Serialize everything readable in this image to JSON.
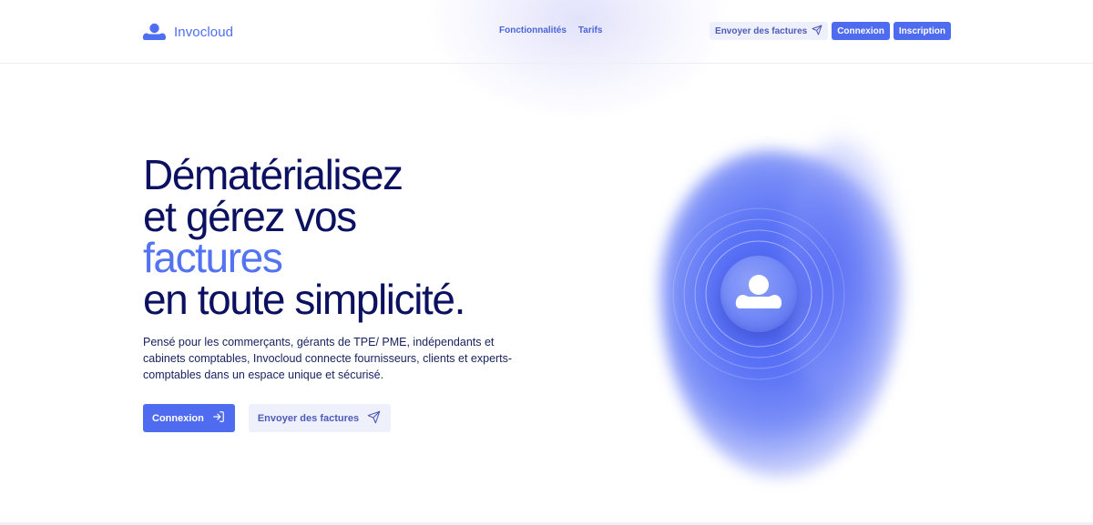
{
  "brand": {
    "name": "Invocloud",
    "logo_icon": "cloud-user-icon"
  },
  "nav": {
    "items": [
      {
        "label": "Fonctionnalités"
      },
      {
        "label": "Tarifs"
      }
    ]
  },
  "header_actions": {
    "send_invoices": "Envoyer des factures",
    "login": "Connexion",
    "signup": "Inscription"
  },
  "hero": {
    "title_line1": "Dématérialisez",
    "title_line2": "et gérez vos",
    "title_accent": "factures",
    "title_line4": "en toute simplicité.",
    "description": "Pensé pour les commerçants, gérants de TPE/ PME, indépendants et cabinets comptables, Invocloud connecte fournisseurs, clients et experts-comptables dans un espace unique et sécurisé.",
    "primary_button": "Connexion",
    "secondary_button": "Envoyer des factures"
  },
  "colors": {
    "accent": "#4f6cf0",
    "title": "#0b1160",
    "ghost_bg": "#eef0fb"
  }
}
